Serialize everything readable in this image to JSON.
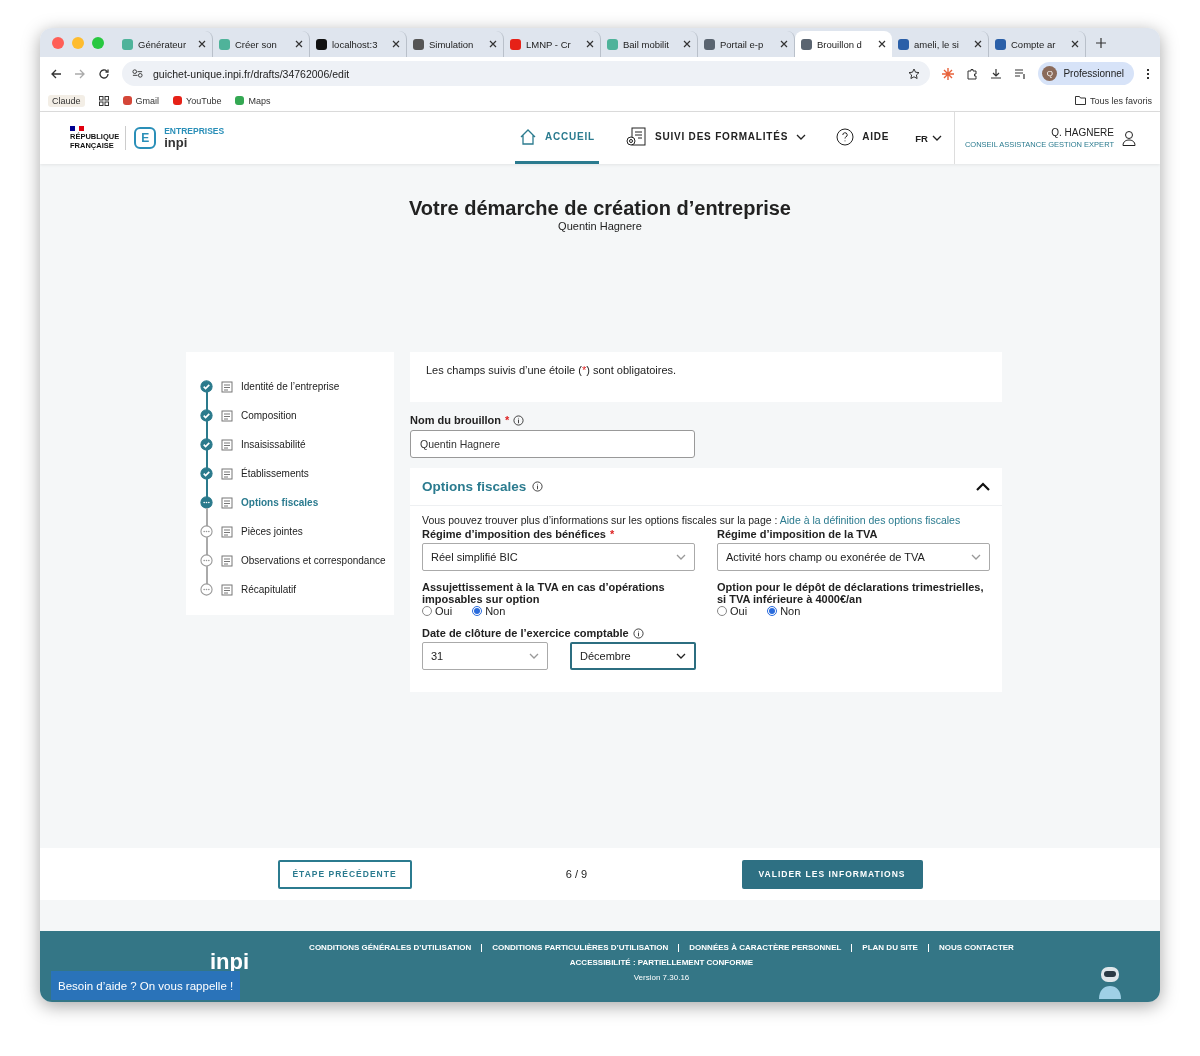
{
  "browser": {
    "tabs": [
      {
        "label": "Générateur",
        "color": "#4fb39a",
        "selected": false
      },
      {
        "label": "Créer son",
        "color": "#4fb39a",
        "selected": false
      },
      {
        "label": "localhost:3",
        "color": "#111111",
        "selected": false
      },
      {
        "label": "Simulation",
        "color": "#555555",
        "selected": false
      },
      {
        "label": "LMNP - Cr",
        "color": "#e62117",
        "selected": false
      },
      {
        "label": "Bail mobilit",
        "color": "#4fb39a",
        "selected": false
      },
      {
        "label": "Portail e-p",
        "color": "#5a6470",
        "selected": false
      },
      {
        "label": "Brouillon d",
        "color": "#5a6470",
        "selected": true
      },
      {
        "label": "ameli, le si",
        "color": "#2a5fa8",
        "selected": false
      },
      {
        "label": "Compte ar",
        "color": "#2a5fa8",
        "selected": false
      }
    ],
    "address": "guichet-unique.inpi.fr/drafts/34762006/edit",
    "profile": {
      "initial": "Q",
      "label": "Professionnel"
    },
    "bookmarks": [
      "Claude",
      "Gmail",
      "YouTube",
      "Maps"
    ],
    "all_bookmarks": "Tous les favoris"
  },
  "site_header": {
    "republic": [
      "RÉPUBLIQUE",
      "FRANÇAISE"
    ],
    "brand_letter": "E",
    "brand_top": "ENTREPRISES",
    "brand_name": "inpi",
    "nav": [
      {
        "label": "ACCUEIL",
        "selected": true,
        "dropdown": false
      },
      {
        "label": "SUIVI DES FORMALITÉS",
        "selected": false,
        "dropdown": true
      },
      {
        "label": "AIDE",
        "selected": false,
        "dropdown": false
      }
    ],
    "language": "FR",
    "user_name": "Q. HAGNERE",
    "user_role": "CONSEIL ASSISTANCE GESTION EXPERT"
  },
  "page": {
    "title": "Votre démarche de création d’entreprise",
    "subtitle": "Quentin Hagnere"
  },
  "steps": [
    {
      "label": "Identité de l’entreprise",
      "completed": true,
      "selected": false
    },
    {
      "label": "Composition",
      "completed": true,
      "selected": false
    },
    {
      "label": "Insaisissabilité",
      "completed": true,
      "selected": false
    },
    {
      "label": "Établissements",
      "completed": true,
      "selected": false
    },
    {
      "label": "Options fiscales",
      "completed": false,
      "selected": true
    },
    {
      "label": "Pièces jointes",
      "completed": false,
      "selected": false
    },
    {
      "label": "Observations et correspondance",
      "completed": false,
      "selected": false
    },
    {
      "label": "Récapitulatif",
      "completed": false,
      "selected": false
    }
  ],
  "notice": {
    "before": "Les champs suivis d’une étoile (",
    "mark": "*",
    "after": ") sont obligatoires."
  },
  "draft_name": {
    "label": "Nom du brouillon",
    "required_mark": "*",
    "value": "Quentin Hagnere"
  },
  "section": {
    "title": "Options fiscales",
    "expanded": true,
    "intro": "Vous pouvez trouver plus d’informations sur les options fiscales sur la page :",
    "link": "Aide à la définition des options fiscales",
    "fields": [
      {
        "kind": "select",
        "label": "Régime d’imposition des bénéfices",
        "required_mark": "*",
        "value": "Réel simplifié BIC"
      },
      {
        "kind": "select",
        "label": "Régime d’imposition de la TVA",
        "value": "Activité hors champ ou exonérée de TVA"
      },
      {
        "kind": "radio",
        "label": "Assujettissement à la TVA en cas d’opérations imposables sur option",
        "options": [
          {
            "label": "Oui",
            "selected": false
          },
          {
            "label": "Non",
            "selected": true
          }
        ]
      },
      {
        "kind": "radio",
        "label": "Option pour le dépôt de déclarations trimestrielles, si TVA inférieure à 4000€/an",
        "options": [
          {
            "label": "Oui",
            "selected": false
          },
          {
            "label": "Non",
            "selected": true
          }
        ]
      },
      {
        "kind": "date",
        "label": "Date de clôture de l’exercice comptable",
        "selects": [
          {
            "value": "31",
            "focused": false
          },
          {
            "value": "Décembre",
            "focused": true
          }
        ]
      }
    ]
  },
  "pager": {
    "previous": "ÉTAPE PRÉCÉDENTE",
    "progress": "6 / 9",
    "next": "VALIDER LES INFORMATIONS"
  },
  "footer": {
    "logo": "inpi",
    "links": [
      "CONDITIONS GÉNÉRALES D’UTILISATION",
      "CONDITIONS PARTICULIÈRES D’UTILISATION",
      "DONNÉES À CARACTÈRE PERSONNEL",
      "PLAN DU SITE",
      "NOUS CONTACTER"
    ],
    "accessibility": "ACCESSIBILITÉ : PARTIELLEMENT CONFORME",
    "version": "Version 7.30.16",
    "help_button": "Besoin d’aide ? On vous rappelle !"
  }
}
